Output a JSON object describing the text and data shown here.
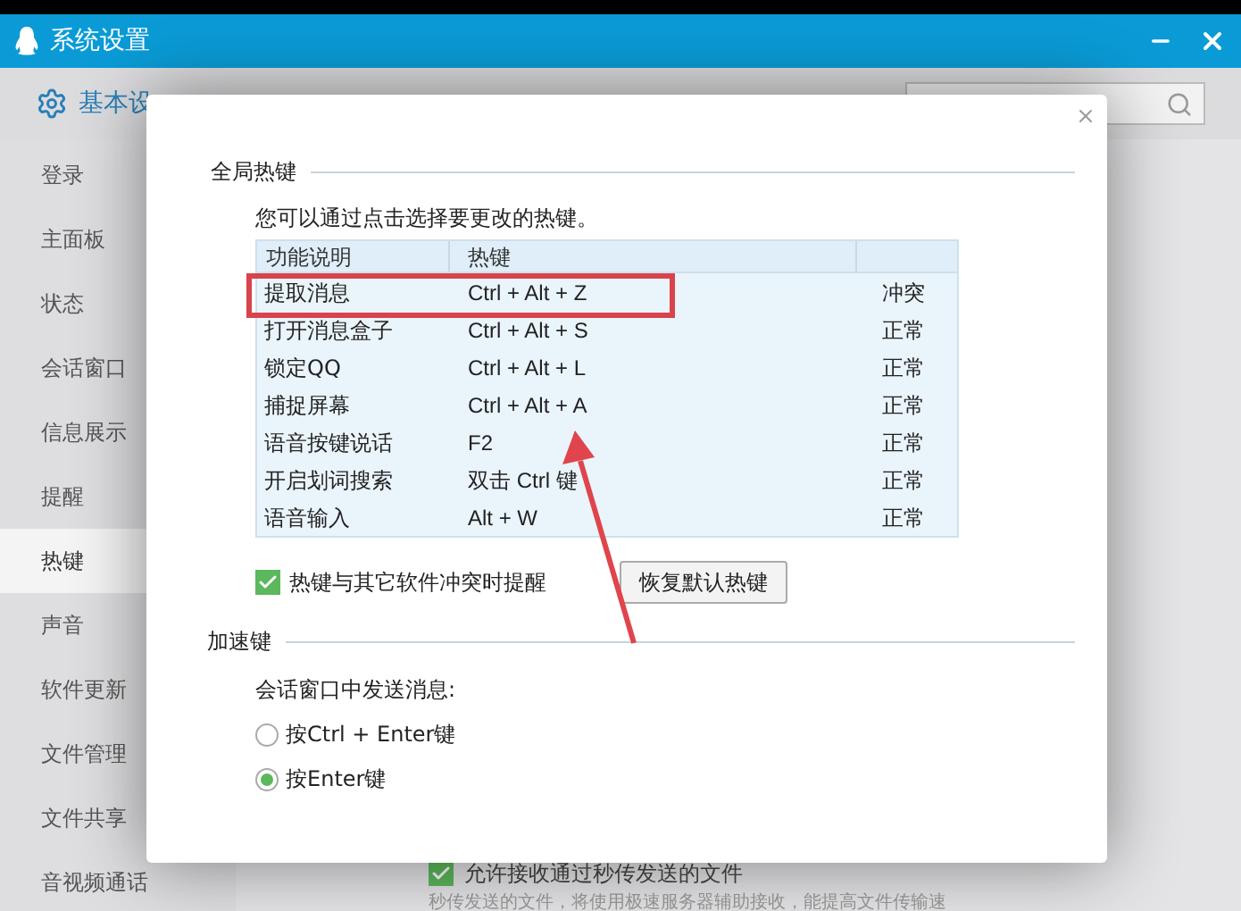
{
  "window": {
    "title": "系统设置"
  },
  "tabs": [
    {
      "label": "基本设",
      "selected": true
    }
  ],
  "sidebar": {
    "items": [
      {
        "label": "登录",
        "selected": false
      },
      {
        "label": "主面板",
        "selected": false
      },
      {
        "label": "状态",
        "selected": false
      },
      {
        "label": "会话窗口",
        "selected": false
      },
      {
        "label": "信息展示",
        "selected": false
      },
      {
        "label": "提醒",
        "selected": false
      },
      {
        "label": "热键",
        "selected": true
      },
      {
        "label": "声音",
        "selected": false
      },
      {
        "label": "软件更新",
        "selected": false
      },
      {
        "label": "文件管理",
        "selected": false
      },
      {
        "label": "文件共享",
        "selected": false
      },
      {
        "label": "音视频通话",
        "selected": false
      }
    ]
  },
  "background_option": {
    "label": "允许接收通过秒传发送的文件",
    "checked": true,
    "note": "秒传发送的文件，将使用极速服务器辅助接收，能提高文件传输速"
  },
  "dialog": {
    "global_hotkeys": {
      "title": "全局热键",
      "hint": "您可以通过点击选择要更改的热键。",
      "columns": [
        "功能说明",
        "热键"
      ],
      "rows": [
        {
          "function": "提取消息",
          "hotkey": "Ctrl + Alt + Z",
          "status": "冲突"
        },
        {
          "function": "打开消息盒子",
          "hotkey": "Ctrl + Alt + S",
          "status": "正常"
        },
        {
          "function": "锁定QQ",
          "hotkey": "Ctrl + Alt + L",
          "status": "正常"
        },
        {
          "function": "捕捉屏幕",
          "hotkey": "Ctrl + Alt + A",
          "status": "正常"
        },
        {
          "function": "语音按键说话",
          "hotkey": "F2",
          "status": "正常"
        },
        {
          "function": "开启划词搜索",
          "hotkey": "双击 Ctrl 键",
          "status": "正常"
        },
        {
          "function": "语音输入",
          "hotkey": "Alt + W",
          "status": "正常"
        }
      ],
      "conflict_alert": {
        "label": "热键与其它软件冲突时提醒",
        "checked": true
      },
      "restore_button": "恢复默认热键"
    },
    "accelerator": {
      "title": "加速键",
      "label": "会话窗口中发送消息:",
      "options": [
        {
          "label": "按Ctrl + Enter键",
          "selected": false
        },
        {
          "label": "按Enter键",
          "selected": true
        }
      ]
    }
  }
}
